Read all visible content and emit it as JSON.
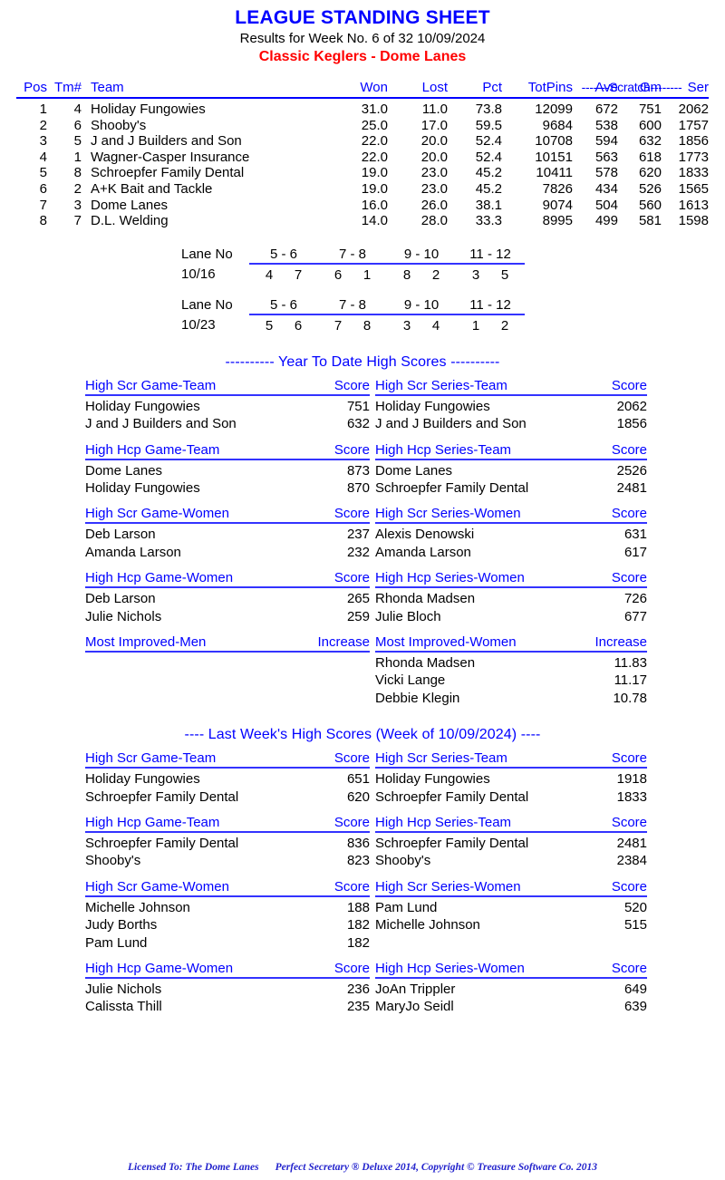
{
  "header": {
    "title": "LEAGUE STANDING SHEET",
    "results_line": "Results for Week No. 6 of 32    10/09/2024",
    "league_line": "Classic Keglers - Dome Lanes"
  },
  "standings": {
    "scratch_label": "-------Scratch--------",
    "columns": {
      "pos": "Pos",
      "tm": "Tm#",
      "team": "Team",
      "won": "Won",
      "lost": "Lost",
      "pct": "Pct",
      "totpins": "TotPins",
      "ave": "Ave",
      "gm": "Gm",
      "ser": "Ser"
    },
    "rows": [
      {
        "pos": "1",
        "tm": "4",
        "team": "Holiday Fungowies",
        "won": "31.0",
        "lost": "11.0",
        "pct": "73.8",
        "totpins": "12099",
        "ave": "672",
        "gm": "751",
        "ser": "2062"
      },
      {
        "pos": "2",
        "tm": "6",
        "team": "Shooby's",
        "won": "25.0",
        "lost": "17.0",
        "pct": "59.5",
        "totpins": "9684",
        "ave": "538",
        "gm": "600",
        "ser": "1757"
      },
      {
        "pos": "3",
        "tm": "5",
        "team": "J and J Builders and Son",
        "won": "22.0",
        "lost": "20.0",
        "pct": "52.4",
        "totpins": "10708",
        "ave": "594",
        "gm": "632",
        "ser": "1856"
      },
      {
        "pos": "4",
        "tm": "1",
        "team": "Wagner-Casper Insurance",
        "won": "22.0",
        "lost": "20.0",
        "pct": "52.4",
        "totpins": "10151",
        "ave": "563",
        "gm": "618",
        "ser": "1773"
      },
      {
        "pos": "5",
        "tm": "8",
        "team": "Schroepfer Family Dental",
        "won": "19.0",
        "lost": "23.0",
        "pct": "45.2",
        "totpins": "10411",
        "ave": "578",
        "gm": "620",
        "ser": "1833"
      },
      {
        "pos": "6",
        "tm": "2",
        "team": "A+K Bait and Tackle",
        "won": "19.0",
        "lost": "23.0",
        "pct": "45.2",
        "totpins": "7826",
        "ave": "434",
        "gm": "526",
        "ser": "1565"
      },
      {
        "pos": "7",
        "tm": "3",
        "team": "Dome Lanes",
        "won": "16.0",
        "lost": "26.0",
        "pct": "38.1",
        "totpins": "9074",
        "ave": "504",
        "gm": "560",
        "ser": "1613"
      },
      {
        "pos": "8",
        "tm": "7",
        "team": "D.L. Welding",
        "won": "14.0",
        "lost": "28.0",
        "pct": "33.3",
        "totpins": "8995",
        "ave": "499",
        "gm": "581",
        "ser": "1598"
      }
    ]
  },
  "lane_schedule": [
    {
      "label": "Lane No",
      "date": "10/16",
      "lanes": [
        "5 - 6",
        "7 - 8",
        "9 - 10",
        "11 - 12"
      ],
      "matchups": [
        [
          "4",
          "7"
        ],
        [
          "6",
          "1"
        ],
        [
          "8",
          "2"
        ],
        [
          "3",
          "5"
        ]
      ]
    },
    {
      "label": "Lane No",
      "date": "10/23",
      "lanes": [
        "5 - 6",
        "7 - 8",
        "9 - 10",
        "11 - 12"
      ],
      "matchups": [
        [
          "5",
          "6"
        ],
        [
          "7",
          "8"
        ],
        [
          "3",
          "4"
        ],
        [
          "1",
          "2"
        ]
      ]
    }
  ],
  "ytd": {
    "heading": "---------- Year To Date High Scores ----------",
    "pairs": [
      [
        {
          "title": "High Scr Game-Team",
          "score_label": "Score",
          "rows": [
            {
              "name": "Holiday Fungowies",
              "score": "751"
            },
            {
              "name": "J and J Builders and Son",
              "score": "632"
            }
          ]
        },
        {
          "title": "High Scr Series-Team",
          "score_label": "Score",
          "rows": [
            {
              "name": "Holiday Fungowies",
              "score": "2062"
            },
            {
              "name": "J and J Builders and Son",
              "score": "1856"
            }
          ]
        }
      ],
      [
        {
          "title": "High Hcp Game-Team",
          "score_label": "Score",
          "rows": [
            {
              "name": "Dome Lanes",
              "score": "873"
            },
            {
              "name": "Holiday Fungowies",
              "score": "870"
            }
          ]
        },
        {
          "title": "High Hcp Series-Team",
          "score_label": "Score",
          "rows": [
            {
              "name": "Dome Lanes",
              "score": "2526"
            },
            {
              "name": "Schroepfer Family Dental",
              "score": "2481"
            }
          ]
        }
      ],
      [
        {
          "title": "High Scr Game-Women",
          "score_label": "Score",
          "rows": [
            {
              "name": "Deb Larson",
              "score": "237"
            },
            {
              "name": "Amanda Larson",
              "score": "232"
            }
          ]
        },
        {
          "title": "High Scr Series-Women",
          "score_label": "Score",
          "rows": [
            {
              "name": "Alexis Denowski",
              "score": "631"
            },
            {
              "name": "Amanda Larson",
              "score": "617"
            }
          ]
        }
      ],
      [
        {
          "title": "High Hcp Game-Women",
          "score_label": "Score",
          "rows": [
            {
              "name": "Deb Larson",
              "score": "265"
            },
            {
              "name": "Julie Nichols",
              "score": "259"
            }
          ]
        },
        {
          "title": "High Hcp Series-Women",
          "score_label": "Score",
          "rows": [
            {
              "name": "Rhonda Madsen",
              "score": "726"
            },
            {
              "name": "Julie Bloch",
              "score": "677"
            }
          ]
        }
      ],
      [
        {
          "title": "Most Improved-Men",
          "score_label": "Increase",
          "rows": []
        },
        {
          "title": "Most Improved-Women",
          "score_label": "Increase",
          "rows": [
            {
              "name": "Rhonda Madsen",
              "score": "11.83"
            },
            {
              "name": "Vicki Lange",
              "score": "11.17"
            },
            {
              "name": "Debbie Klegin",
              "score": "10.78"
            }
          ]
        }
      ]
    ]
  },
  "last_week": {
    "heading": "----  Last Week's High Scores   (Week of 10/09/2024)  ----",
    "pairs": [
      [
        {
          "title": "High Scr Game-Team",
          "score_label": "Score",
          "rows": [
            {
              "name": "Holiday Fungowies",
              "score": "651"
            },
            {
              "name": "Schroepfer Family Dental",
              "score": "620"
            }
          ]
        },
        {
          "title": "High Scr Series-Team",
          "score_label": "Score",
          "rows": [
            {
              "name": "Holiday Fungowies",
              "score": "1918"
            },
            {
              "name": "Schroepfer Family Dental",
              "score": "1833"
            }
          ]
        }
      ],
      [
        {
          "title": "High Hcp Game-Team",
          "score_label": "Score",
          "rows": [
            {
              "name": "Schroepfer Family Dental",
              "score": "836"
            },
            {
              "name": "Shooby's",
              "score": "823"
            }
          ]
        },
        {
          "title": "High Hcp Series-Team",
          "score_label": "Score",
          "rows": [
            {
              "name": "Schroepfer Family Dental",
              "score": "2481"
            },
            {
              "name": "Shooby's",
              "score": "2384"
            }
          ]
        }
      ],
      [
        {
          "title": "High Scr Game-Women",
          "score_label": "Score",
          "rows": [
            {
              "name": "Michelle Johnson",
              "score": "188"
            },
            {
              "name": "Judy Borths",
              "score": "182"
            },
            {
              "name": "Pam Lund",
              "score": "182"
            }
          ]
        },
        {
          "title": "High Scr Series-Women",
          "score_label": "Score",
          "rows": [
            {
              "name": "Pam Lund",
              "score": "520"
            },
            {
              "name": "Michelle Johnson",
              "score": "515"
            }
          ]
        }
      ],
      [
        {
          "title": "High Hcp Game-Women",
          "score_label": "Score",
          "rows": [
            {
              "name": "Julie Nichols",
              "score": "236"
            },
            {
              "name": "Calissta Thill",
              "score": "235"
            }
          ]
        },
        {
          "title": "High Hcp Series-Women",
          "score_label": "Score",
          "rows": [
            {
              "name": "JoAn Trippler",
              "score": "649"
            },
            {
              "name": "MaryJo Seidl",
              "score": "639"
            }
          ]
        }
      ]
    ]
  },
  "footer": {
    "licensed_to": "Licensed To: The Dome Lanes",
    "software": "Perfect Secretary ® Deluxe  2014, Copyright © Treasure Software Co. 2013"
  },
  "colors": {
    "blue": "#0000FF",
    "red": "#FF0000",
    "rule": "#3333FF"
  }
}
